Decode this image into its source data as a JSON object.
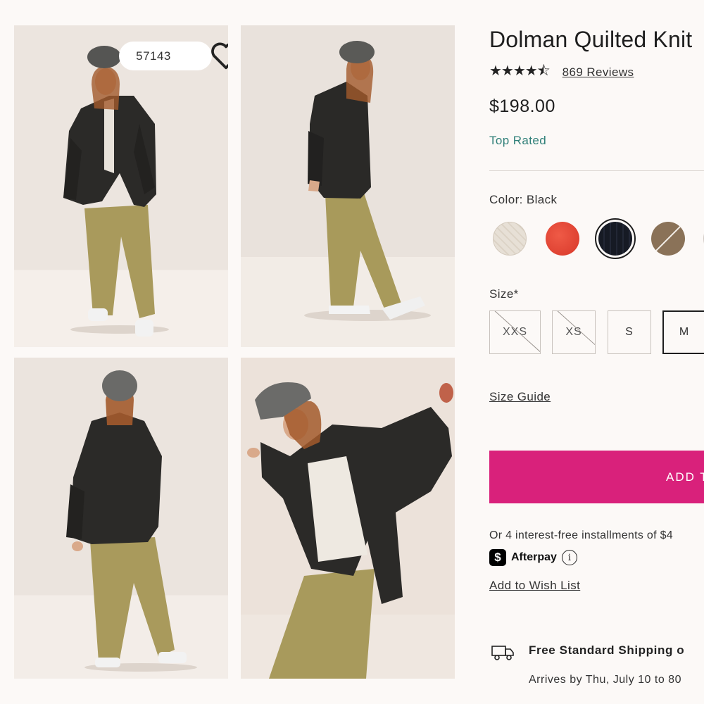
{
  "gallery": {
    "like_count": "57143",
    "photos": [
      {
        "alt": "front view"
      },
      {
        "alt": "side view"
      },
      {
        "alt": "back view"
      },
      {
        "alt": "motion view"
      }
    ]
  },
  "product": {
    "title": "Dolman Quilted Knit",
    "stars": "★★★★⯪",
    "rating": 4.5,
    "reviews_label": "869 Reviews",
    "price": "$198.00",
    "badge": "Top Rated",
    "color_label": "Color: Black",
    "swatches": [
      {
        "name": "cream",
        "color": "#e7e0d6",
        "available": true
      },
      {
        "name": "red",
        "color": "#e34634",
        "available": true
      },
      {
        "name": "black",
        "color": "#161a24",
        "available": true,
        "selected": true
      },
      {
        "name": "brown",
        "color": "#8a7258",
        "available": false
      },
      {
        "name": "partial",
        "color": "#e6e0da",
        "available": true
      }
    ],
    "size_label": "Size*",
    "sizes": [
      {
        "label": "XXS",
        "available": false
      },
      {
        "label": "XS",
        "available": false
      },
      {
        "label": "S",
        "available": true
      },
      {
        "label": "M",
        "available": true,
        "selected": true
      }
    ],
    "size_guide": "Size Guide",
    "add_button": "ADD T",
    "installments": "Or 4 interest-free installments of $4",
    "afterpay": "Afterpay",
    "wishlist": "Add to Wish List",
    "shipping_title": "Free Standard Shipping o",
    "shipping_sub": "Arrives by Thu, July 10 to 80"
  },
  "colors": {
    "accent": "#d9217b",
    "badge": "#2f7f78",
    "background": "#fcf9f7"
  }
}
